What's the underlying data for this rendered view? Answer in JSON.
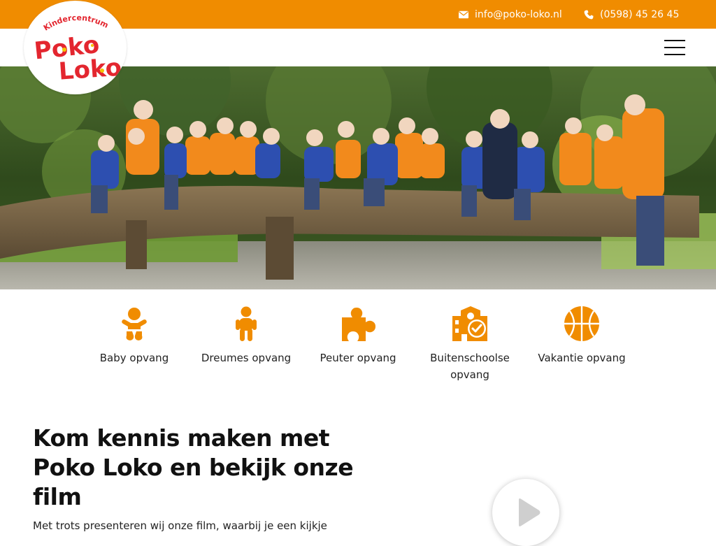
{
  "topbar": {
    "email": "info@poko-loko.nl",
    "phone": "(0598) 45 26 45"
  },
  "logo": {
    "subtitle": "Kindercentrum",
    "line1": "Poko",
    "line2": "Loko"
  },
  "services": [
    {
      "label": "Baby opvang",
      "icon": "baby-icon"
    },
    {
      "label": "Dreumes opvang",
      "icon": "child-icon"
    },
    {
      "label": "Peuter opvang",
      "icon": "puzzle-icon"
    },
    {
      "label": "Buitenschoolse opvang",
      "icon": "school-clock-icon"
    },
    {
      "label": "Vakantie opvang",
      "icon": "basketball-icon"
    }
  ],
  "intro": {
    "title": "Kom kennis maken met Poko Loko en bekijk onze film",
    "text": "Met trots presenteren wij onze film, waarbij je een kijkje"
  },
  "colors": {
    "brand_orange": "#f08c00",
    "logo_red": "#e3262f",
    "text": "#111111"
  }
}
